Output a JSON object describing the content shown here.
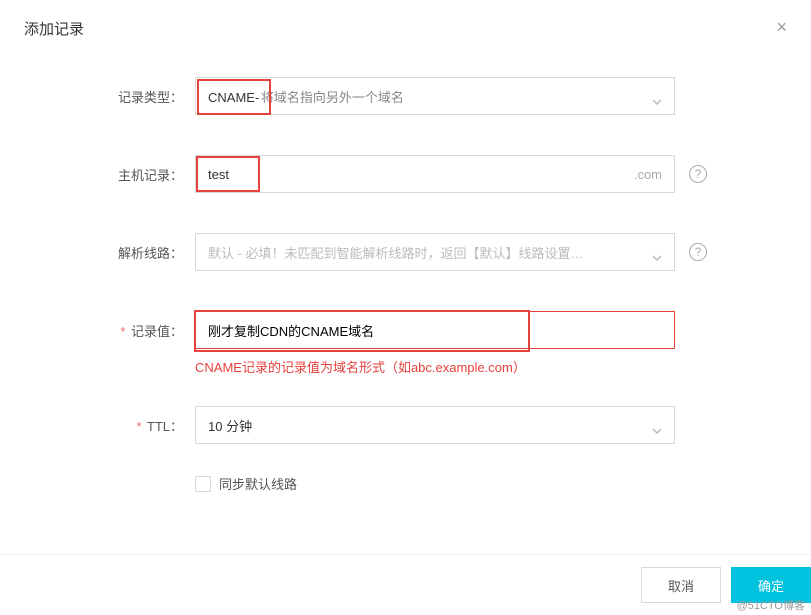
{
  "modal": {
    "title": "添加记录",
    "close": "×"
  },
  "labels": {
    "record_type": "记录类型：",
    "host_record": "主机记录：",
    "resolution_line": "解析线路：",
    "record_value": "* 记录值：",
    "ttl": "* TTL：",
    "sync_default": "同步默认线路"
  },
  "fields": {
    "record_type_prefix": "CNAME- ",
    "record_type_rest": "将域名指向另外一个域名",
    "host_record_value": "test",
    "host_record_suffix": ".com",
    "resolution_line_text": "默认 - 必填！未匹配到智能解析线路时，返回【默认】线路设置…",
    "record_value_value": "刚才复制CDN的CNAME域名",
    "record_value_error": "CNAME记录的记录值为域名形式（如abc.example.com）",
    "ttl_value": "10 分钟"
  },
  "footer": {
    "cancel": "取消",
    "confirm": "确定"
  },
  "help_glyph": "?",
  "watermark": "@51CTO博客"
}
